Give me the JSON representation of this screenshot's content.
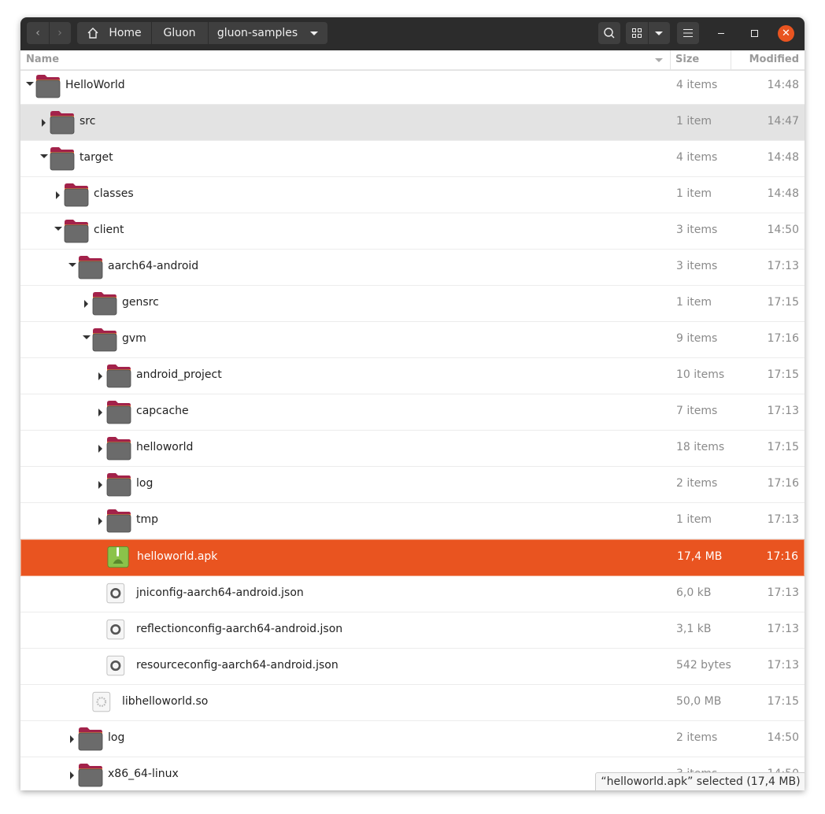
{
  "window": {
    "breadcrumb": [
      "Home",
      "Gluon",
      "gluon-samples"
    ],
    "columns": {
      "name": "Name",
      "size": "Size",
      "modified": "Modified"
    },
    "accent_color": "#e95420",
    "status": "“helloworld.apk” selected  (17,4 MB)"
  },
  "rows": [
    {
      "depth": 0,
      "expander": "open",
      "icon": "folder",
      "name": "HelloWorld",
      "size": "4 items",
      "modified": "14:48"
    },
    {
      "depth": 1,
      "expander": "closed",
      "icon": "folder",
      "name": "src",
      "size": "1 item",
      "modified": "14:47",
      "state": "hover"
    },
    {
      "depth": 1,
      "expander": "open",
      "icon": "folder",
      "name": "target",
      "size": "4 items",
      "modified": "14:48"
    },
    {
      "depth": 2,
      "expander": "closed",
      "icon": "folder",
      "name": "classes",
      "size": "1 item",
      "modified": "14:48"
    },
    {
      "depth": 2,
      "expander": "open",
      "icon": "folder",
      "name": "client",
      "size": "3 items",
      "modified": "14:50"
    },
    {
      "depth": 3,
      "expander": "open",
      "icon": "folder",
      "name": "aarch64-android",
      "size": "3 items",
      "modified": "17:13"
    },
    {
      "depth": 4,
      "expander": "closed",
      "icon": "folder",
      "name": "gensrc",
      "size": "1 item",
      "modified": "17:15"
    },
    {
      "depth": 4,
      "expander": "open",
      "icon": "folder",
      "name": "gvm",
      "size": "9 items",
      "modified": "17:16"
    },
    {
      "depth": 5,
      "expander": "closed",
      "icon": "folder",
      "name": "android_project",
      "size": "10 items",
      "modified": "17:15"
    },
    {
      "depth": 5,
      "expander": "closed",
      "icon": "folder",
      "name": "capcache",
      "size": "7 items",
      "modified": "17:13"
    },
    {
      "depth": 5,
      "expander": "closed",
      "icon": "folder",
      "name": "helloworld",
      "size": "18 items",
      "modified": "17:15"
    },
    {
      "depth": 5,
      "expander": "closed",
      "icon": "folder",
      "name": "log",
      "size": "2 items",
      "modified": "17:16"
    },
    {
      "depth": 5,
      "expander": "closed",
      "icon": "folder",
      "name": "tmp",
      "size": "1 item",
      "modified": "17:13"
    },
    {
      "depth": 5,
      "expander": "none",
      "icon": "apk",
      "name": "helloworld.apk",
      "size": "17,4 MB",
      "modified": "17:16",
      "state": "selected"
    },
    {
      "depth": 5,
      "expander": "none",
      "icon": "json",
      "name": "jniconfig-aarch64-android.json",
      "size": "6,0 kB",
      "modified": "17:13"
    },
    {
      "depth": 5,
      "expander": "none",
      "icon": "json",
      "name": "reflectionconfig-aarch64-android.json",
      "size": "3,1 kB",
      "modified": "17:13"
    },
    {
      "depth": 5,
      "expander": "none",
      "icon": "json",
      "name": "resourceconfig-aarch64-android.json",
      "size": "542 bytes",
      "modified": "17:13"
    },
    {
      "depth": 4,
      "expander": "none",
      "icon": "library",
      "name": "libhelloworld.so",
      "size": "50,0 MB",
      "modified": "17:15"
    },
    {
      "depth": 3,
      "expander": "closed",
      "icon": "folder",
      "name": "log",
      "size": "2 items",
      "modified": "14:50"
    },
    {
      "depth": 3,
      "expander": "closed",
      "icon": "folder",
      "name": "x86_64-linux",
      "size": "3 items",
      "modified": "14:50"
    }
  ]
}
